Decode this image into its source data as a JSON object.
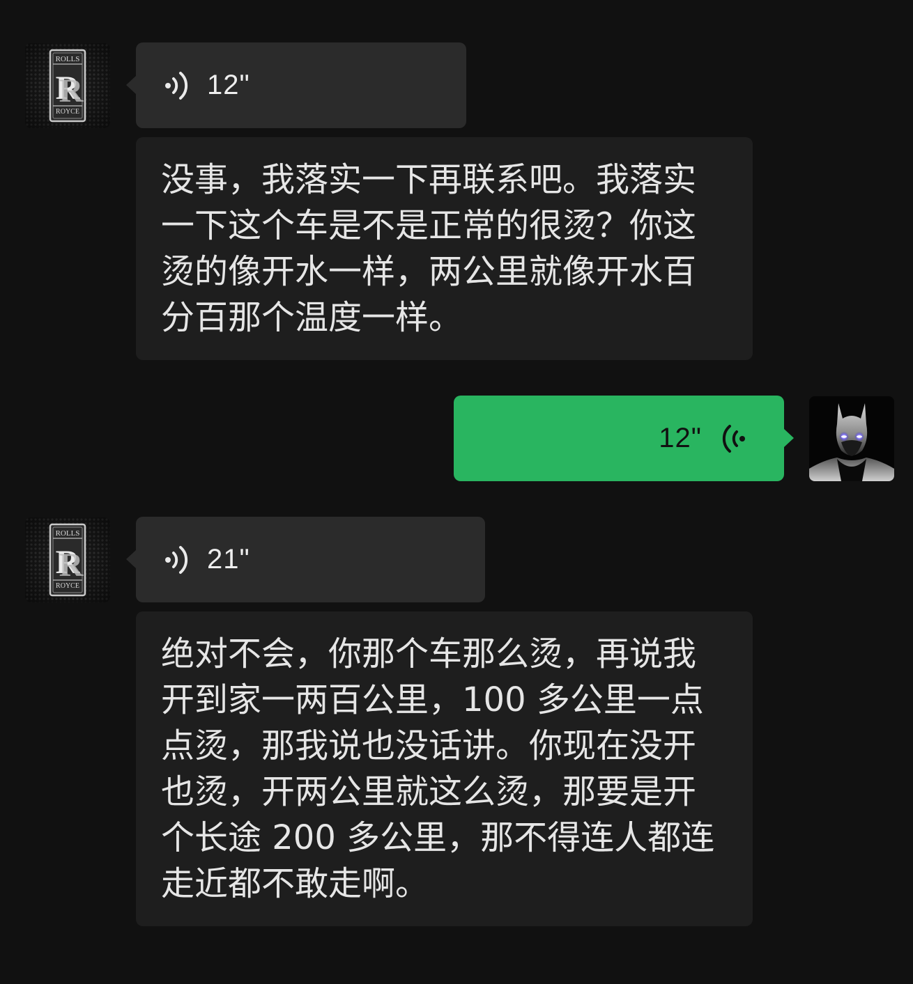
{
  "messages": [
    {
      "sender": "rolls-royce",
      "type": "voice",
      "duration": "12\""
    },
    {
      "sender": "rolls-royce",
      "type": "text",
      "text": "没事，我落实一下再联系吧。我落实\n一下这个车是不是正常的很烫？你这\n烫的像开水一样，两公里就像开水百\n分百那个温度一样。"
    },
    {
      "sender": "me",
      "type": "voice",
      "duration": "12\""
    },
    {
      "sender": "rolls-royce",
      "type": "voice",
      "duration": "21\""
    },
    {
      "sender": "rolls-royce",
      "type": "text",
      "text": "绝对不会，你那个车那么烫，再说我\n开到家一两百公里，100 多公里一点\n点烫，那我说也没话讲。你现在没开\n也烫，开两公里就这么烫，那要是开\n个长途 200 多公里，那不得连人都连\n走近都不敢走啊。"
    }
  ],
  "avatars": {
    "rolls_royce_logo_text_top": "ROLLS",
    "rolls_royce_logo_text_bottom": "ROYCE",
    "me_icon": "batman-icon"
  },
  "colors": {
    "background": "#111111",
    "incoming_bubble": "#2b2b2b",
    "outgoing_bubble": "#29b560"
  }
}
